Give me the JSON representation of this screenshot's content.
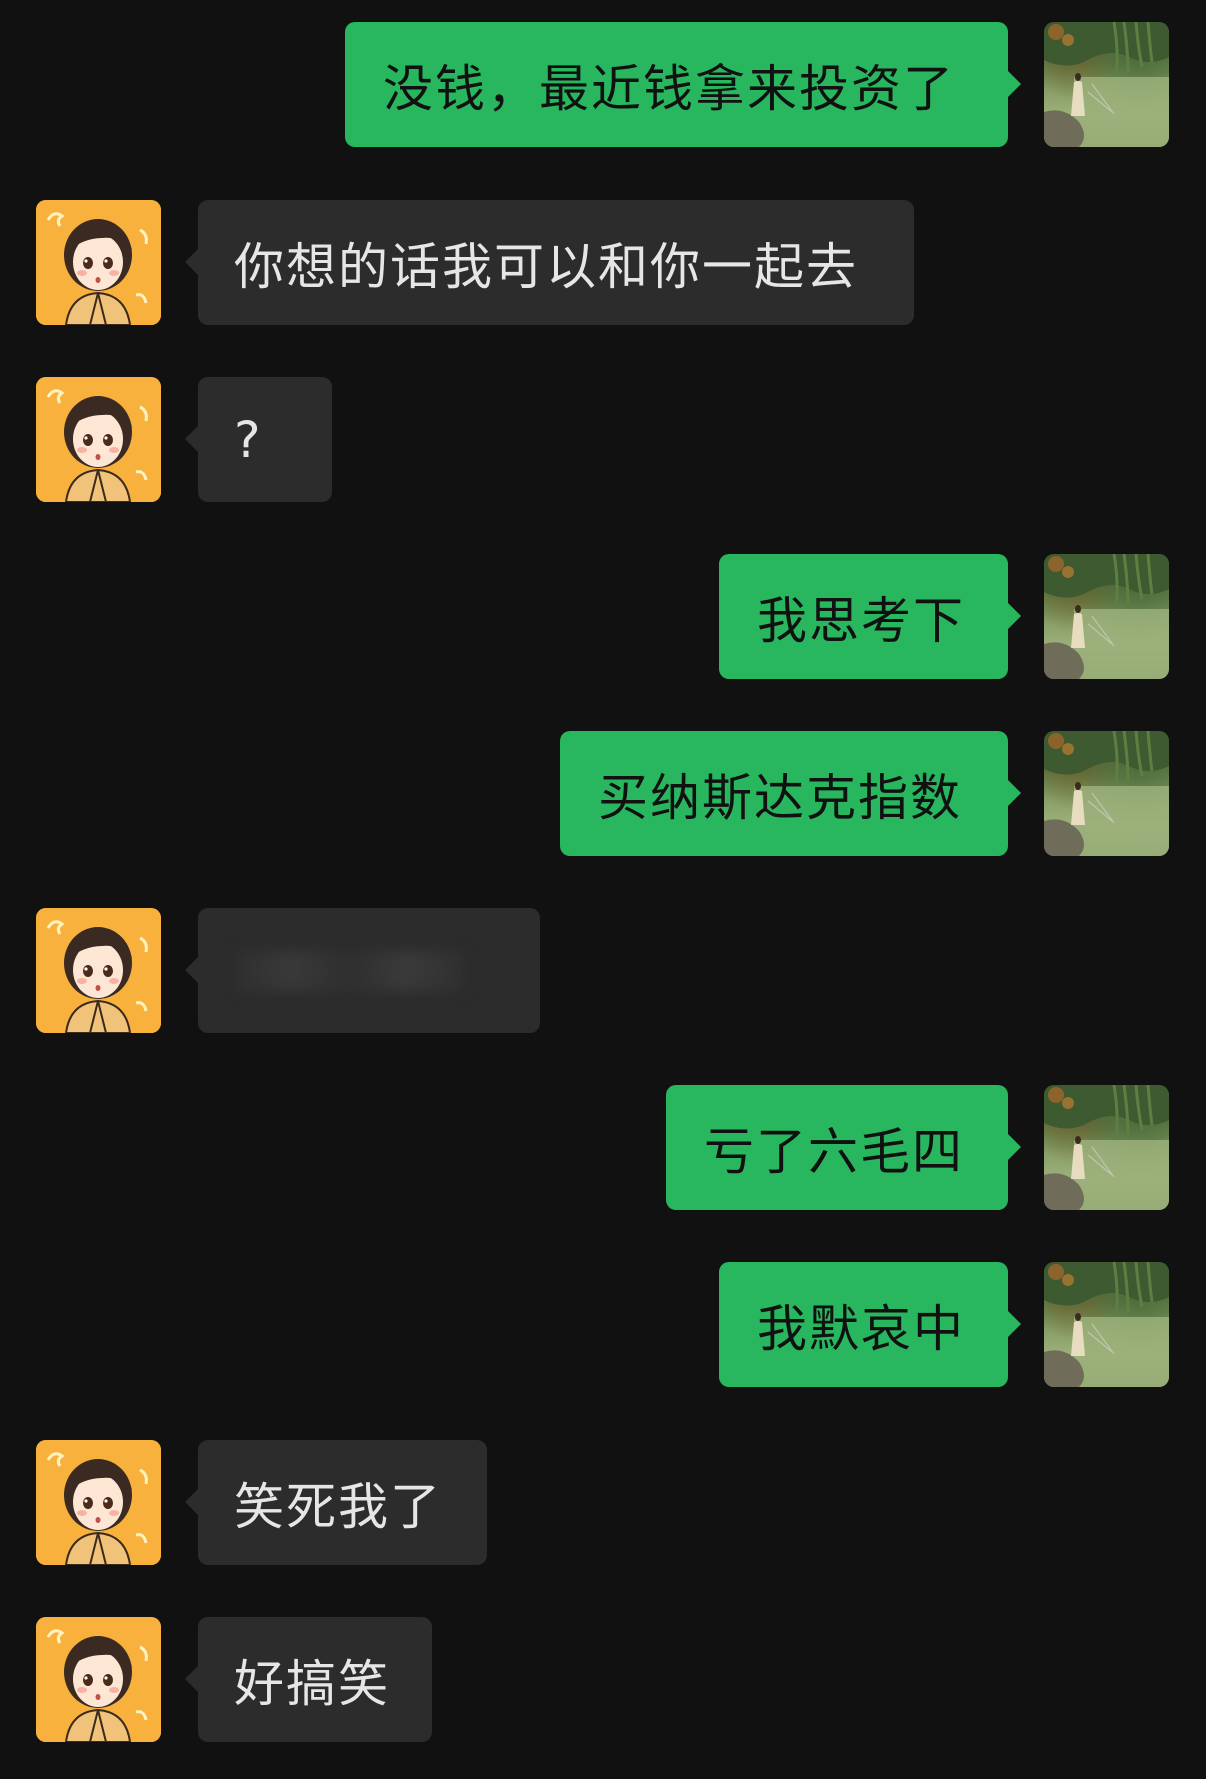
{
  "colors": {
    "background": "#111111",
    "sent_bubble": "#28b75f",
    "received_bubble": "#2c2c2c",
    "avatar_cartoon_bg": "#f9b13d"
  },
  "messages": [
    {
      "side": "right",
      "avatar": "landscape-photo-avatar",
      "text": "没钱，最近钱拿来投资了"
    },
    {
      "side": "left",
      "avatar": "cartoon-avatar",
      "text": "你想的话我可以和你一起去"
    },
    {
      "side": "left",
      "avatar": "cartoon-avatar",
      "text": "?"
    },
    {
      "side": "right",
      "avatar": "landscape-photo-avatar",
      "text": "我思考下"
    },
    {
      "side": "right",
      "avatar": "landscape-photo-avatar",
      "text": "买纳斯达克指数"
    },
    {
      "side": "left",
      "avatar": "cartoon-avatar",
      "text": "",
      "redacted": true
    },
    {
      "side": "right",
      "avatar": "landscape-photo-avatar",
      "text": "亏了六毛四"
    },
    {
      "side": "right",
      "avatar": "landscape-photo-avatar",
      "text": "我默哀中"
    },
    {
      "side": "left",
      "avatar": "cartoon-avatar",
      "text": "笑死我了"
    },
    {
      "side": "left",
      "avatar": "cartoon-avatar",
      "text": "好搞笑"
    }
  ]
}
